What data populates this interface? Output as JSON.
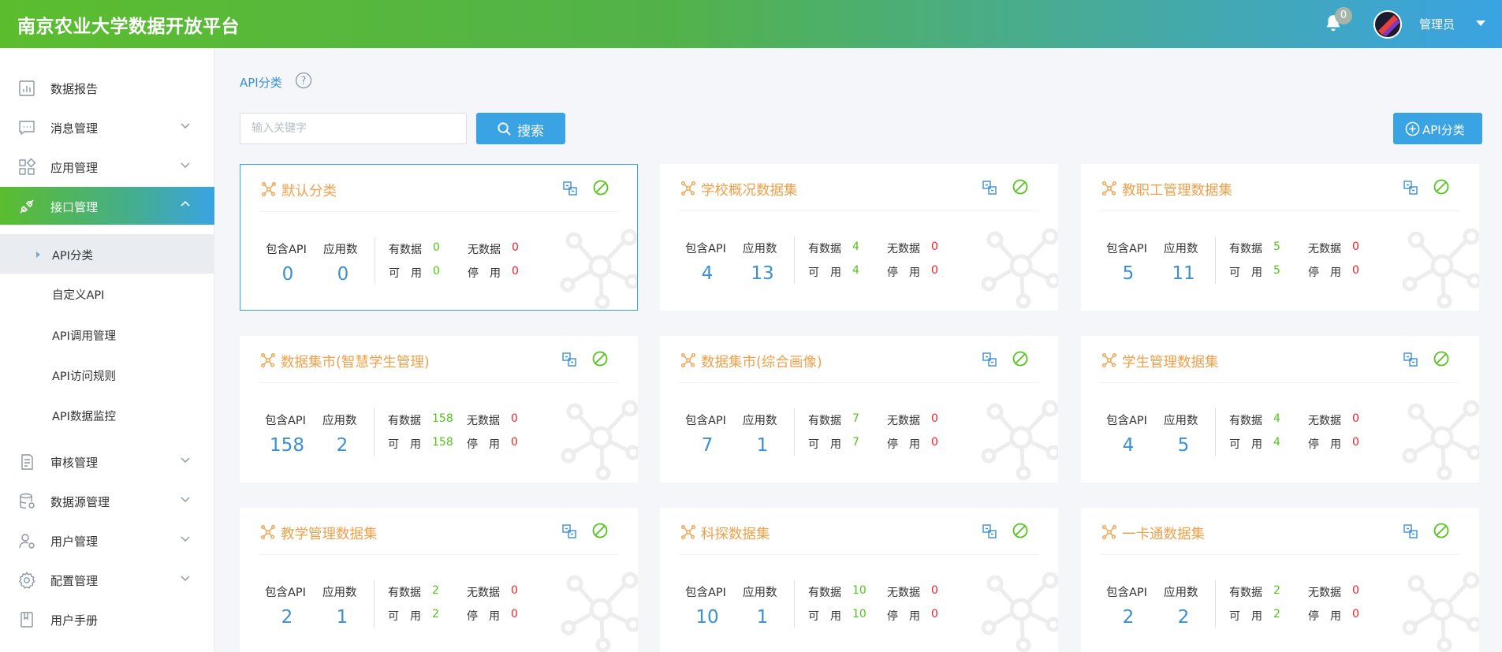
{
  "header": {
    "title": "南京农业大学数据开放平台",
    "notification_count": "0",
    "user_name": "管理员"
  },
  "sidebar": {
    "items": [
      {
        "label": "数据报告",
        "icon": "bar-chart-icon",
        "expandable": false
      },
      {
        "label": "消息管理",
        "icon": "message-icon",
        "expandable": true
      },
      {
        "label": "应用管理",
        "icon": "apps-icon",
        "expandable": true
      },
      {
        "label": "接口管理",
        "icon": "interface-icon",
        "expandable": true,
        "active": true
      },
      {
        "label": "审核管理",
        "icon": "audit-icon",
        "expandable": true
      },
      {
        "label": "数据源管理",
        "icon": "database-icon",
        "expandable": true
      },
      {
        "label": "用户管理",
        "icon": "user-icon",
        "expandable": true
      },
      {
        "label": "配置管理",
        "icon": "gear-icon",
        "expandable": true
      },
      {
        "label": "用户手册",
        "icon": "book-icon",
        "expandable": false
      }
    ],
    "sub_items": [
      {
        "label": "API分类",
        "selected": true
      },
      {
        "label": "自定义API"
      },
      {
        "label": "API调用管理"
      },
      {
        "label": "API访问规则"
      },
      {
        "label": "API数据监控"
      }
    ]
  },
  "main": {
    "breadcrumb": "API分类",
    "search_placeholder": "输入关键字",
    "search_label": "搜索",
    "add_label": "API分类"
  },
  "labels": {
    "api_count": "包含API",
    "app_count": "应用数",
    "has_data": "有数据",
    "no_data": "无数据",
    "available": "可　用",
    "disabled": "停　用"
  },
  "colors": {
    "accent_blue": "#3aa3e3",
    "header_green": "#5bbd2e",
    "title_orange": "#f0a04a",
    "value_green": "#52c41a",
    "value_red": "#f5222d"
  },
  "cards": [
    {
      "title": "默认分类",
      "api": "0",
      "apps": "0",
      "has_data": "0",
      "no_data": "0",
      "available": "0",
      "disabled": "0",
      "selected": true
    },
    {
      "title": "学校概况数据集",
      "api": "4",
      "apps": "13",
      "has_data": "4",
      "no_data": "0",
      "available": "4",
      "disabled": "0"
    },
    {
      "title": "教职工管理数据集",
      "api": "5",
      "apps": "11",
      "has_data": "5",
      "no_data": "0",
      "available": "5",
      "disabled": "0"
    },
    {
      "title": "数据集市(智慧学生管理)",
      "api": "158",
      "apps": "2",
      "has_data": "158",
      "no_data": "0",
      "available": "158",
      "disabled": "0"
    },
    {
      "title": "数据集市(综合画像)",
      "api": "7",
      "apps": "1",
      "has_data": "7",
      "no_data": "0",
      "available": "7",
      "disabled": "0"
    },
    {
      "title": "学生管理数据集",
      "api": "4",
      "apps": "5",
      "has_data": "4",
      "no_data": "0",
      "available": "4",
      "disabled": "0"
    },
    {
      "title": "教学管理数据集",
      "api": "2",
      "apps": "1",
      "has_data": "2",
      "no_data": "0",
      "available": "2",
      "disabled": "0"
    },
    {
      "title": "科探数据集",
      "api": "10",
      "apps": "1",
      "has_data": "10",
      "no_data": "0",
      "available": "10",
      "disabled": "0"
    },
    {
      "title": "一卡通数据集",
      "api": "2",
      "apps": "2",
      "has_data": "2",
      "no_data": "0",
      "available": "2",
      "disabled": "0"
    }
  ]
}
